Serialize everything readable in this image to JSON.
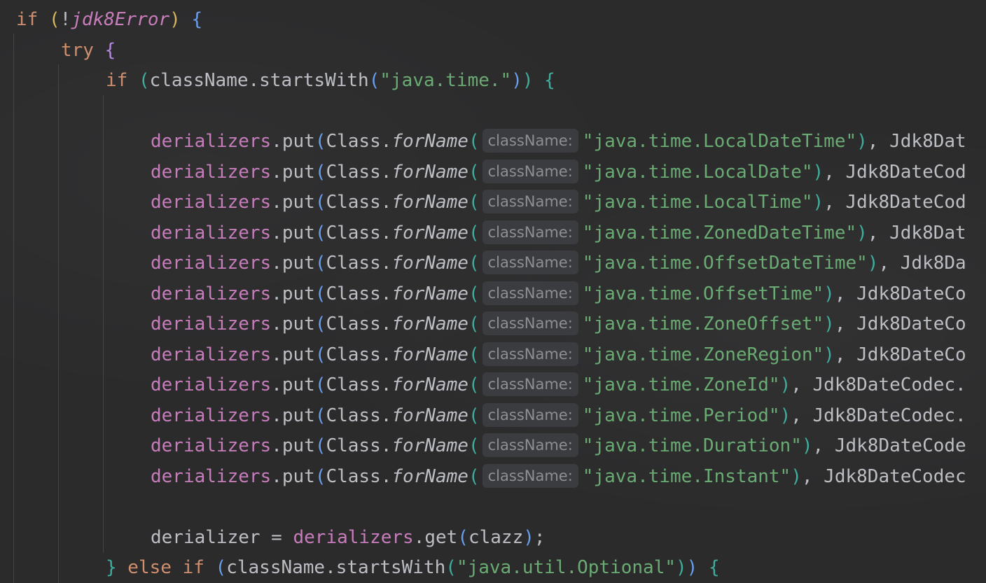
{
  "code": {
    "line1": {
      "kw": "if",
      "open": "(",
      "not": "!",
      "var": "jdk8Error",
      "close": ")",
      "brace": "{"
    },
    "line2": {
      "kw": "try",
      "brace": "{"
    },
    "line3": {
      "kw": "if",
      "open": "(",
      "recv": "className.startsWith",
      "p2": "(",
      "str": "\"java.time.\"",
      "p2c": ")",
      "close": ")",
      "brace": "{"
    },
    "put_lines": [
      {
        "field": "derializers",
        "call": ".put",
        "p1": "(",
        "cls": "Class.",
        "method": "forName",
        "p2": "(",
        "hint": "className:",
        "str": "\"java.time.LocalDateTime\"",
        "p2c": ")",
        "rest": ", Jdk8Dat"
      },
      {
        "field": "derializers",
        "call": ".put",
        "p1": "(",
        "cls": "Class.",
        "method": "forName",
        "p2": "(",
        "hint": "className:",
        "str": "\"java.time.LocalDate\"",
        "p2c": ")",
        "rest": ", Jdk8DateCod"
      },
      {
        "field": "derializers",
        "call": ".put",
        "p1": "(",
        "cls": "Class.",
        "method": "forName",
        "p2": "(",
        "hint": "className:",
        "str": "\"java.time.LocalTime\"",
        "p2c": ")",
        "rest": ", Jdk8DateCod"
      },
      {
        "field": "derializers",
        "call": ".put",
        "p1": "(",
        "cls": "Class.",
        "method": "forName",
        "p2": "(",
        "hint": "className:",
        "str": "\"java.time.ZonedDateTime\"",
        "p2c": ")",
        "rest": ", Jdk8Dat"
      },
      {
        "field": "derializers",
        "call": ".put",
        "p1": "(",
        "cls": "Class.",
        "method": "forName",
        "p2": "(",
        "hint": "className:",
        "str": "\"java.time.OffsetDateTime\"",
        "p2c": ")",
        "rest": ", Jdk8Da"
      },
      {
        "field": "derializers",
        "call": ".put",
        "p1": "(",
        "cls": "Class.",
        "method": "forName",
        "p2": "(",
        "hint": "className:",
        "str": "\"java.time.OffsetTime\"",
        "p2c": ")",
        "rest": ", Jdk8DateCo"
      },
      {
        "field": "derializers",
        "call": ".put",
        "p1": "(",
        "cls": "Class.",
        "method": "forName",
        "p2": "(",
        "hint": "className:",
        "str": "\"java.time.ZoneOffset\"",
        "p2c": ")",
        "rest": ", Jdk8DateCo"
      },
      {
        "field": "derializers",
        "call": ".put",
        "p1": "(",
        "cls": "Class.",
        "method": "forName",
        "p2": "(",
        "hint": "className:",
        "str": "\"java.time.ZoneRegion\"",
        "p2c": ")",
        "rest": ", Jdk8DateCo"
      },
      {
        "field": "derializers",
        "call": ".put",
        "p1": "(",
        "cls": "Class.",
        "method": "forName",
        "p2": "(",
        "hint": "className:",
        "str": "\"java.time.ZoneId\"",
        "p2c": ")",
        "rest": ", Jdk8DateCodec."
      },
      {
        "field": "derializers",
        "call": ".put",
        "p1": "(",
        "cls": "Class.",
        "method": "forName",
        "p2": "(",
        "hint": "className:",
        "str": "\"java.time.Period\"",
        "p2c": ")",
        "rest": ", Jdk8DateCodec."
      },
      {
        "field": "derializers",
        "call": ".put",
        "p1": "(",
        "cls": "Class.",
        "method": "forName",
        "p2": "(",
        "hint": "className:",
        "str": "\"java.time.Duration\"",
        "p2c": ")",
        "rest": ", Jdk8DateCode"
      },
      {
        "field": "derializers",
        "call": ".put",
        "p1": "(",
        "cls": "Class.",
        "method": "forName",
        "p2": "(",
        "hint": "className:",
        "str": "\"java.time.Instant\"",
        "p2c": ")",
        "rest": ", Jdk8DateCodec"
      }
    ],
    "assign_line": {
      "lhs": "derializer = ",
      "field": "derializers",
      "call": ".get",
      "open": "(",
      "arg": "clazz",
      "close": ")",
      "end": ";"
    },
    "else_line": {
      "brace": "}",
      "kw": " else if ",
      "open": "(",
      "recv": "className.startsWith",
      "p2": "(",
      "str": "\"java.util.Optional\"",
      "p2c": ")",
      "close": ")",
      "ob": " {"
    }
  },
  "colors": {
    "background": "#2b2b2c",
    "keyword": "#cf8e6d",
    "field": "#c77dbb",
    "string": "#6aab73",
    "default": "#bcbec4",
    "inlay_hint_bg": "#3b3c3f"
  }
}
